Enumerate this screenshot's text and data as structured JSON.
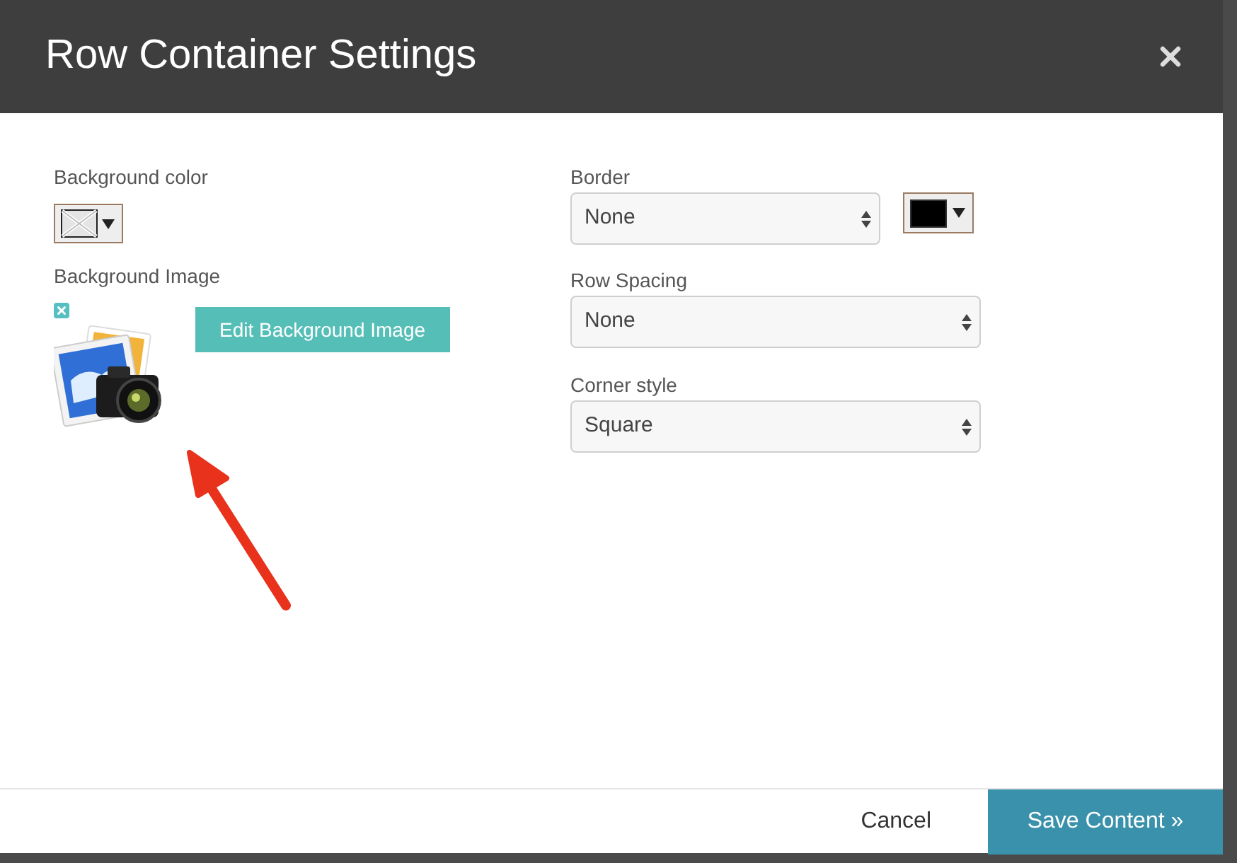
{
  "dialog": {
    "title": "Row Container Settings"
  },
  "background_color": {
    "label": "Background color"
  },
  "background_image": {
    "label": "Background Image",
    "edit_button": "Edit Background Image"
  },
  "border": {
    "label": "Border",
    "value": "None",
    "color": "#000000"
  },
  "row_spacing": {
    "label": "Row Spacing",
    "value": "None"
  },
  "corner_style": {
    "label": "Corner style",
    "value": "Square"
  },
  "footer": {
    "cancel": "Cancel",
    "save": "Save Content »"
  }
}
